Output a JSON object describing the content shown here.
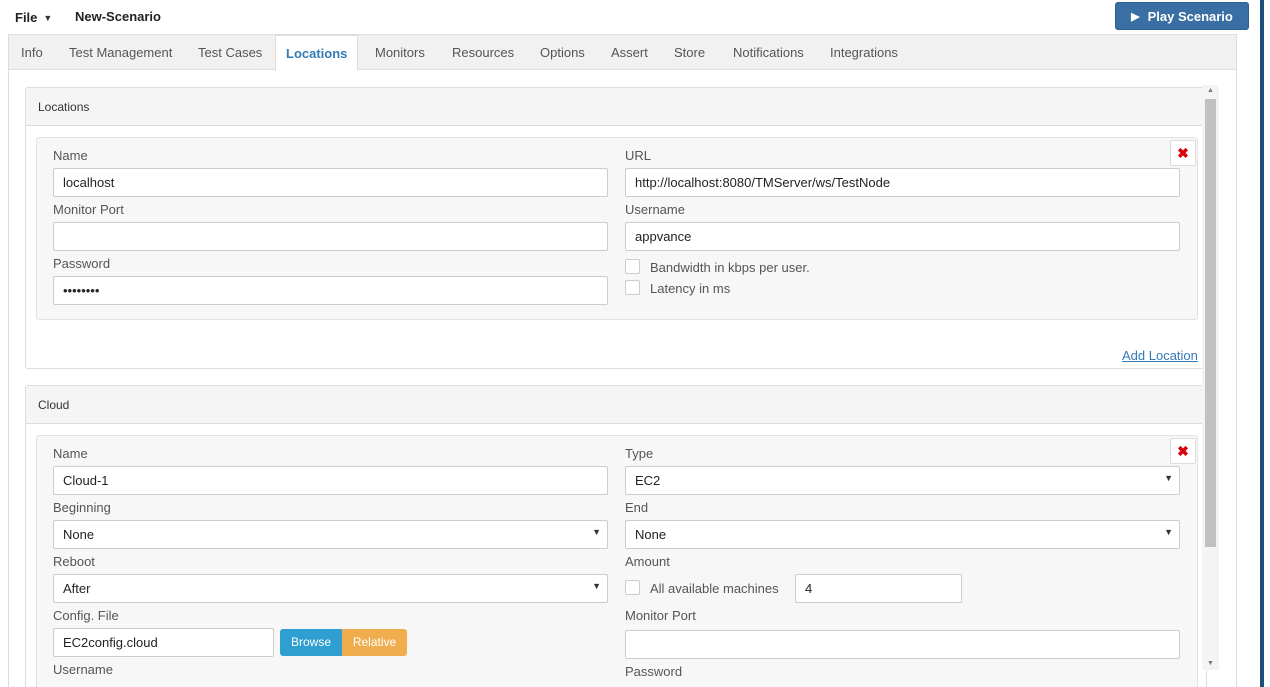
{
  "topbar": {
    "file_label": "File",
    "scenario_name": "New-Scenario",
    "play_label": "Play Scenario"
  },
  "tabs": [
    {
      "label": "Info"
    },
    {
      "label": "Test Management"
    },
    {
      "label": "Test Cases"
    },
    {
      "label": "Locations",
      "active": true
    },
    {
      "label": "Monitors"
    },
    {
      "label": "Resources"
    },
    {
      "label": "Options"
    },
    {
      "label": "Assert"
    },
    {
      "label": "Store"
    },
    {
      "label": "Notifications"
    },
    {
      "label": "Integrations"
    }
  ],
  "locations_panel": {
    "title": "Locations",
    "name_label": "Name",
    "name_value": "localhost",
    "url_label": "URL",
    "url_value": "http://localhost:8080/TMServer/ws/TestNode",
    "monitor_port_label": "Monitor Port",
    "monitor_port_value": "",
    "username_label": "Username",
    "username_value": "appvance",
    "password_label": "Password",
    "password_value": "••••••••",
    "bandwidth_label": "Bandwidth in kbps per user.",
    "latency_label": "Latency in ms",
    "delete_glyph": "✖",
    "add_location_label": "Add Location"
  },
  "cloud_panel": {
    "title": "Cloud",
    "name_label": "Name",
    "name_value": "Cloud-1",
    "type_label": "Type",
    "type_value": "EC2",
    "beginning_label": "Beginning",
    "beginning_value": "None",
    "end_label": "End",
    "end_value": "None",
    "reboot_label": "Reboot",
    "reboot_value": "After",
    "amount_label": "Amount",
    "all_machines_label": "All available machines",
    "amount_value": "4",
    "config_file_label": "Config. File",
    "config_file_value": "EC2config.cloud",
    "browse_label": "Browse",
    "relative_label": "Relative",
    "monitor_port_label": "Monitor Port",
    "monitor_port_value": "",
    "username_label": "Username",
    "password_label": "Password",
    "delete_glyph": "✖"
  },
  "colors": {
    "accent": "#337ab7",
    "play_button": "#3a6fa3",
    "browse_button": "#2e9fd0",
    "relative_button": "#f0ad4e",
    "delete": "#d9000d"
  }
}
